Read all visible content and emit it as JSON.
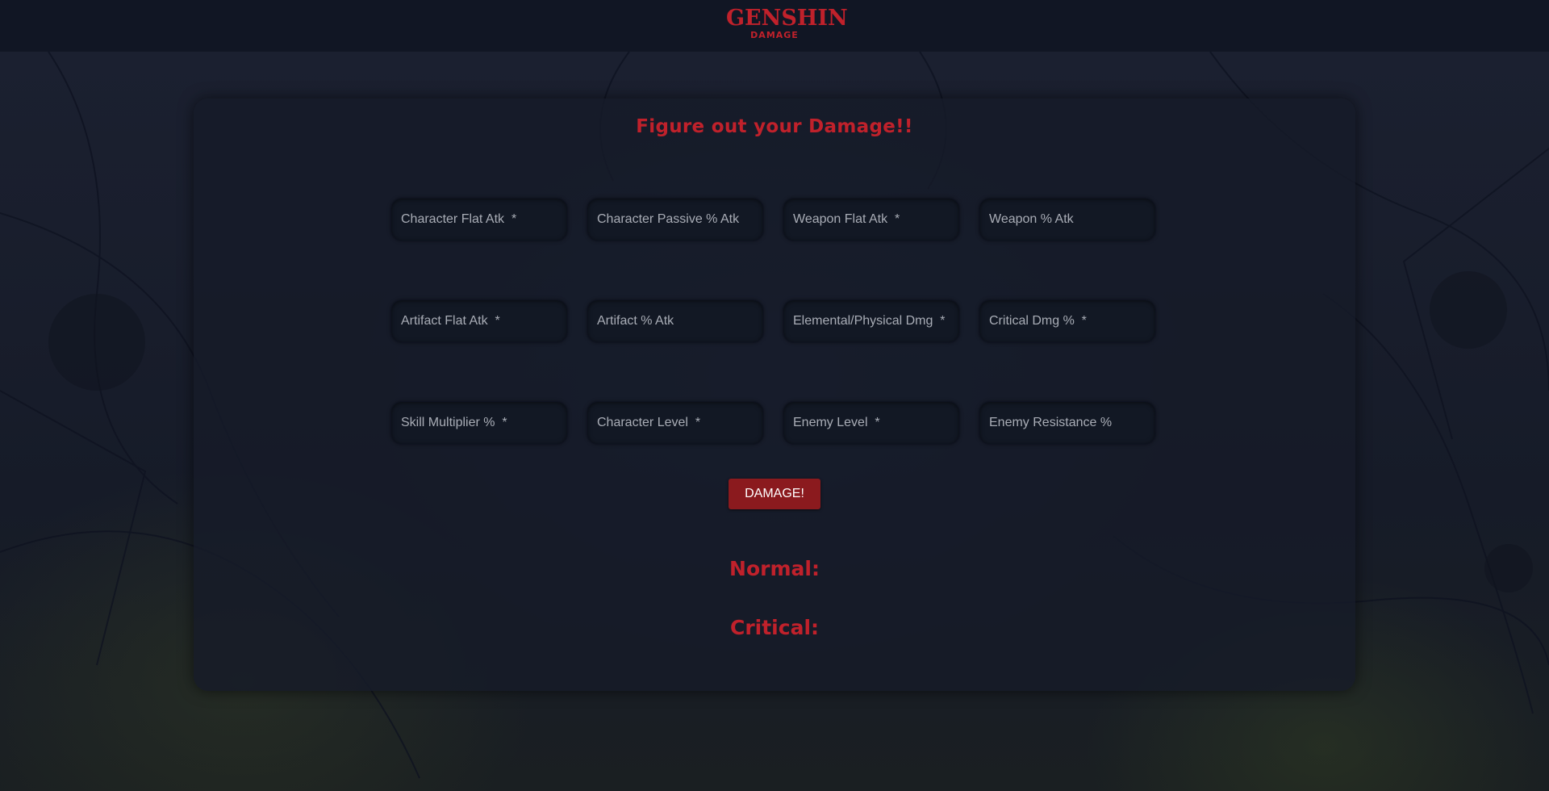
{
  "header": {
    "logo_main": "GENSHIN",
    "logo_sub": "DAMAGE"
  },
  "calculator": {
    "title": "Figure out your Damage!!",
    "fields": [
      {
        "placeholder": "Character Flat Atk  *",
        "value": ""
      },
      {
        "placeholder": "Character Passive % Atk",
        "value": ""
      },
      {
        "placeholder": "Weapon Flat Atk  *",
        "value": ""
      },
      {
        "placeholder": "Weapon % Atk",
        "value": ""
      },
      {
        "placeholder": "Artifact Flat Atk  *",
        "value": ""
      },
      {
        "placeholder": "Artifact % Atk",
        "value": ""
      },
      {
        "placeholder": "Elemental/Physical Dmg  *",
        "value": ""
      },
      {
        "placeholder": "Critical Dmg %  *",
        "value": ""
      },
      {
        "placeholder": "Skill Multiplier %  *",
        "value": ""
      },
      {
        "placeholder": "Character Level  *",
        "value": ""
      },
      {
        "placeholder": "Enemy Level  *",
        "value": ""
      },
      {
        "placeholder": "Enemy Resistance %",
        "value": ""
      }
    ],
    "submit_label": "DAMAGE!",
    "normal_label": "Normal:",
    "critical_label": "Critical:"
  },
  "colors": {
    "accent": "#c0212b",
    "button": "#8b1a1e",
    "background": "#141826"
  }
}
